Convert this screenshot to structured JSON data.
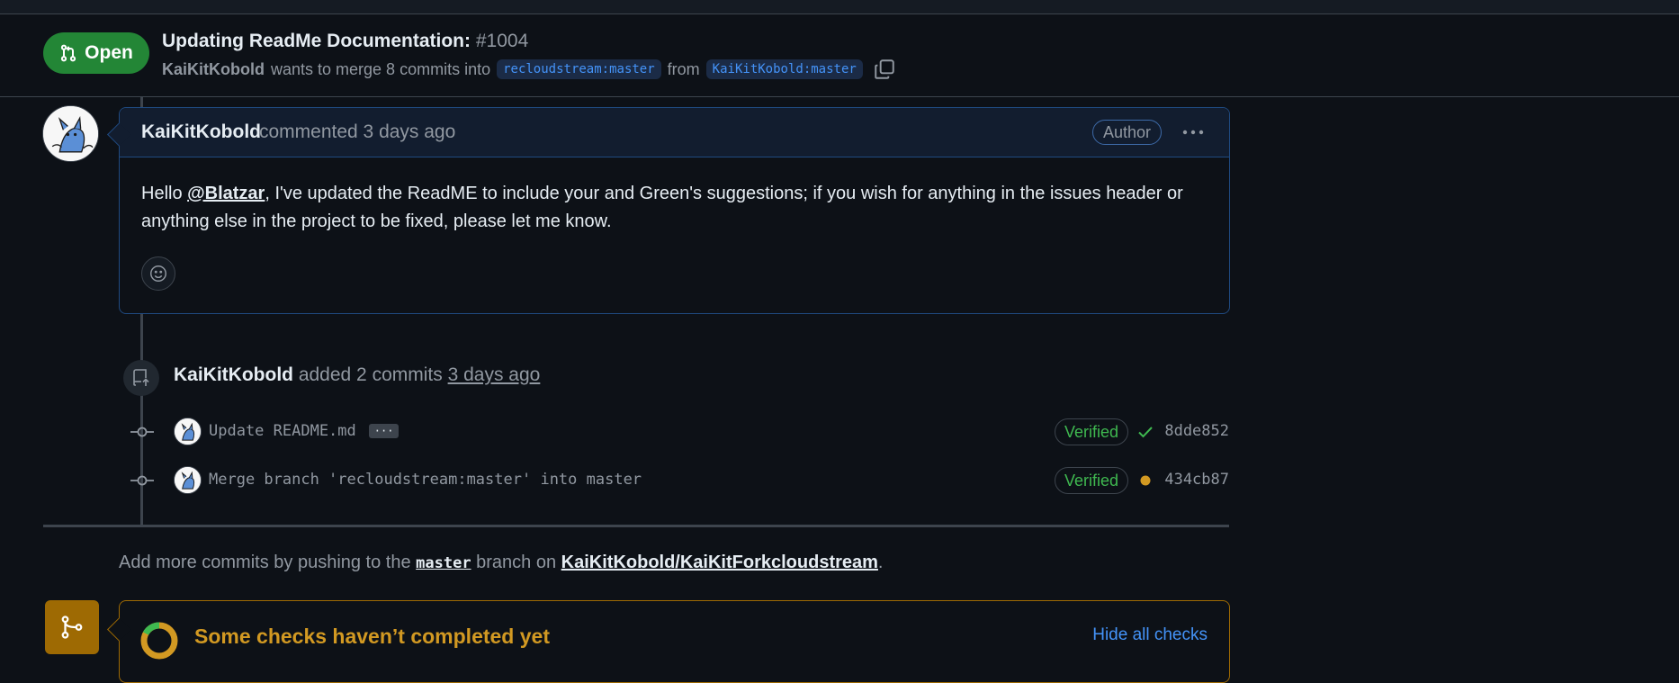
{
  "pr": {
    "state": "Open",
    "title": "Updating ReadMe Documentation:",
    "number": "#1004",
    "author": "KaiKitKobold",
    "merge_text": "wants to merge 8 commits into",
    "base_branch": "recloudstream:master",
    "from_text": "from",
    "head_branch": "KaiKitKobold:master"
  },
  "comment": {
    "author": "KaiKitKobold",
    "time": "commented 3 days ago",
    "badge": "Author",
    "body_prefix": "Hello ",
    "mention": "@Blatzar",
    "body_rest": ", I've updated the ReadME to include your and Green's suggestions; if you wish for anything in the issues header or anything else in the project to be fixed, please let me know."
  },
  "commit_event": {
    "actor": "KaiKitKobold",
    "action": "added 2 commits",
    "when": "3 days ago",
    "commits": [
      {
        "message": "Update README.md",
        "has_more": true,
        "more_label": "···",
        "verified": "Verified",
        "status": "success",
        "sha": "8dde852"
      },
      {
        "message": "Merge branch 'recloudstream:master' into master",
        "has_more": false,
        "more_label": "",
        "verified": "Verified",
        "status": "pending",
        "sha": "434cb87"
      }
    ]
  },
  "push_note": {
    "prefix": "Add more commits by pushing to the ",
    "branch": "master",
    "middle": " branch on ",
    "repo": "KaiKitKobold/KaiKitForkcloudstream",
    "suffix": "."
  },
  "checks": {
    "title": "Some checks haven’t completed yet",
    "hide_label": "Hide all checks"
  },
  "colors": {
    "open_green": "#238636",
    "verified_green": "#3fb950",
    "pending_yellow": "#d29922",
    "link_blue": "#4493f8"
  }
}
